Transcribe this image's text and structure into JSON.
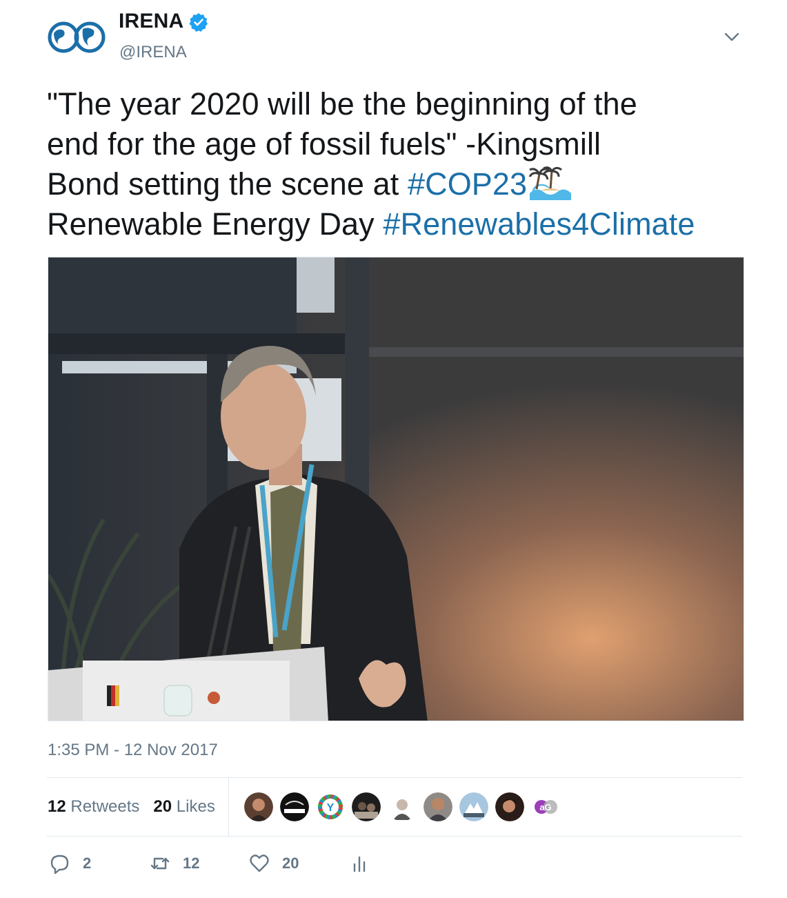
{
  "header": {
    "display_name": "IRENA",
    "handle": "@IRENA",
    "avatar_icon": "irena-globe-logo",
    "verified_icon": "verified-badge-icon",
    "menu_icon": "chevron-down-icon"
  },
  "tweet": {
    "text_line1": "\"The year 2020 will be the beginning of the",
    "text_line2": "end for the age of fossil fuels\" -Kingsmill",
    "text_line3": "Bond setting the scene at ",
    "hashtag_cop": "#COP23",
    "emoji": "island-wave-emoji",
    "text_line4": "Renewable Energy Day ",
    "hashtag_renewables": "#Renewables4Climate",
    "photo": "speaker-at-podium-photo"
  },
  "timestamp": "1:35 PM - 12 Nov 2017",
  "stats": {
    "retweets_count": "12",
    "retweets_label": "Retweets",
    "likes_count": "20",
    "likes_label": "Likes",
    "likers": [
      "user-avatar-1",
      "user-avatar-2",
      "user-avatar-3",
      "user-avatar-4",
      "user-avatar-5",
      "user-avatar-6",
      "user-avatar-7",
      "user-avatar-8",
      "user-avatar-9"
    ]
  },
  "actions": {
    "reply_count": "2",
    "retweet_count": "12",
    "like_count": "20",
    "icons": [
      "reply-icon",
      "retweet-icon",
      "like-icon",
      "analytics-icon"
    ]
  },
  "colors": {
    "link": "#1b6fa8",
    "muted": "#657786",
    "text": "#14171a",
    "verified": "#1da1f2"
  }
}
